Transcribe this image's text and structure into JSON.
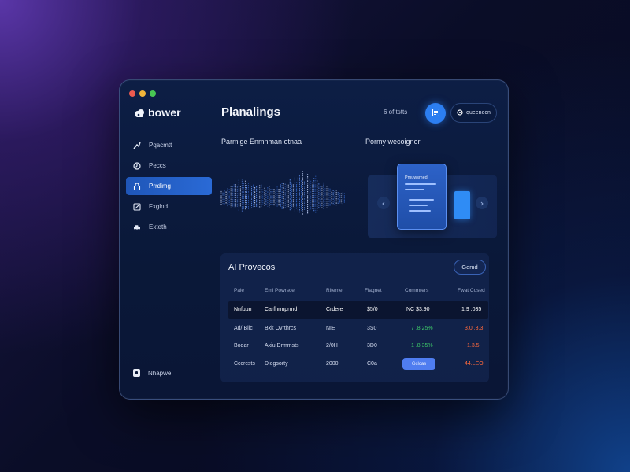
{
  "window": {
    "controls": [
      "close",
      "minimize",
      "maximize"
    ]
  },
  "brand": {
    "name": "bower",
    "icon": "cloud-icon"
  },
  "sidebar": {
    "items": [
      {
        "label": "Pqacmtt",
        "icon": "chart-icon",
        "active": false
      },
      {
        "label": "Peccs",
        "icon": "clock-icon",
        "active": false
      },
      {
        "label": "Prrdimg",
        "icon": "lock-icon",
        "active": true
      },
      {
        "label": "Fxglnd",
        "icon": "edit-icon",
        "active": false
      },
      {
        "label": "Exteth",
        "icon": "car-icon",
        "active": false
      }
    ],
    "bottom_label": "Nhapwe"
  },
  "header": {
    "title": "Planalings",
    "count_text": "6 of tstts",
    "action_pill": "queenecn"
  },
  "wave_section": {
    "title": "Parmlge Enmnman otnaa"
  },
  "promo_section": {
    "title": "Pormy wecoigner",
    "card_title": "Pmuwsmed"
  },
  "table": {
    "title": "AI Provecos",
    "button": "Gemd",
    "headers": [
      "Pale",
      "Eml Powrsce",
      "Riteme",
      "Fiagnet",
      "Commrers",
      "Fwat Cosed"
    ],
    "rows": [
      {
        "cells": [
          "Nnfuun",
          "Carfhrmprmd",
          "Crdere",
          "$5/0",
          "NC $3.90",
          "1.9 .035"
        ],
        "change_dir": "",
        "final_dir": "",
        "highlight": true
      },
      {
        "cells": [
          "Ad/ Blic",
          "Bxk Ovrthrcs",
          "NIE",
          "3S0",
          "7 .8.25%",
          "3.0 .3.3"
        ],
        "change_dir": "up",
        "final_dir": "down",
        "highlight": false
      },
      {
        "cells": [
          "Bodar",
          "Axiu Drmmsts",
          "2/0H",
          "3D0",
          "1 .8.35%",
          "1.3.5"
        ],
        "change_dir": "up",
        "final_dir": "down",
        "highlight": false
      },
      {
        "cells": [
          "Cccrcsts",
          "Diegsorty",
          "2000",
          "C0a",
          "Gclcas",
          "44.LEO"
        ],
        "change_dir": "button",
        "final_dir": "down",
        "highlight": false
      }
    ]
  },
  "colors": {
    "accent": "#2c7ef0",
    "active_nav": "#2a6ad6",
    "positive": "#3ecb6a",
    "negative": "#ff6a3d"
  }
}
